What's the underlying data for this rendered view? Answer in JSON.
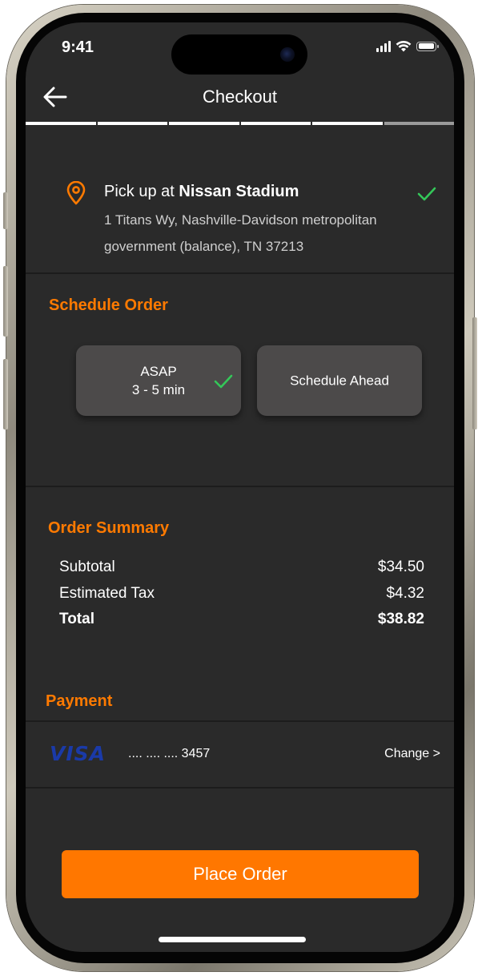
{
  "status_bar": {
    "time": "9:41",
    "signal_icon": "cellular-signal-icon",
    "wifi_icon": "wifi-icon",
    "battery_icon": "battery-icon"
  },
  "header": {
    "title": "Checkout",
    "back_icon": "back-arrow-icon"
  },
  "progress": {
    "total_steps": 6,
    "completed_steps": 5,
    "active_color": "#ffffff",
    "inactive_color": "#9a9a9a"
  },
  "pickup": {
    "prefix": "Pick up at ",
    "venue": "Nissan Stadium",
    "address": "1 Titans Wy, Nashville-Davidson metropolitan government (balance), TN 37213",
    "pin_icon": "location-pin-icon",
    "check_icon": "check-icon"
  },
  "schedule": {
    "heading": "Schedule Order",
    "options": [
      {
        "line1": "ASAP",
        "line2": "3 - 5 min",
        "selected": true
      },
      {
        "line1": "Schedule Ahead",
        "line2": "",
        "selected": false
      }
    ]
  },
  "summary": {
    "heading": "Order Summary",
    "rows": [
      {
        "label": "Subtotal",
        "value": "$34.50"
      },
      {
        "label": "Estimated Tax",
        "value": "$4.32"
      },
      {
        "label": "Total",
        "value": "$38.82"
      }
    ]
  },
  "payment": {
    "heading": "Payment",
    "card_brand": "VISA",
    "card_number": ".... .... .... 3457",
    "change_label": "Change >"
  },
  "actions": {
    "place_order_label": "Place Order"
  },
  "colors": {
    "accent": "#ff7a00",
    "background": "#2a2a2a",
    "card": "#4c4a4a",
    "success": "#34c759",
    "visa_blue": "#1a3aa8"
  }
}
